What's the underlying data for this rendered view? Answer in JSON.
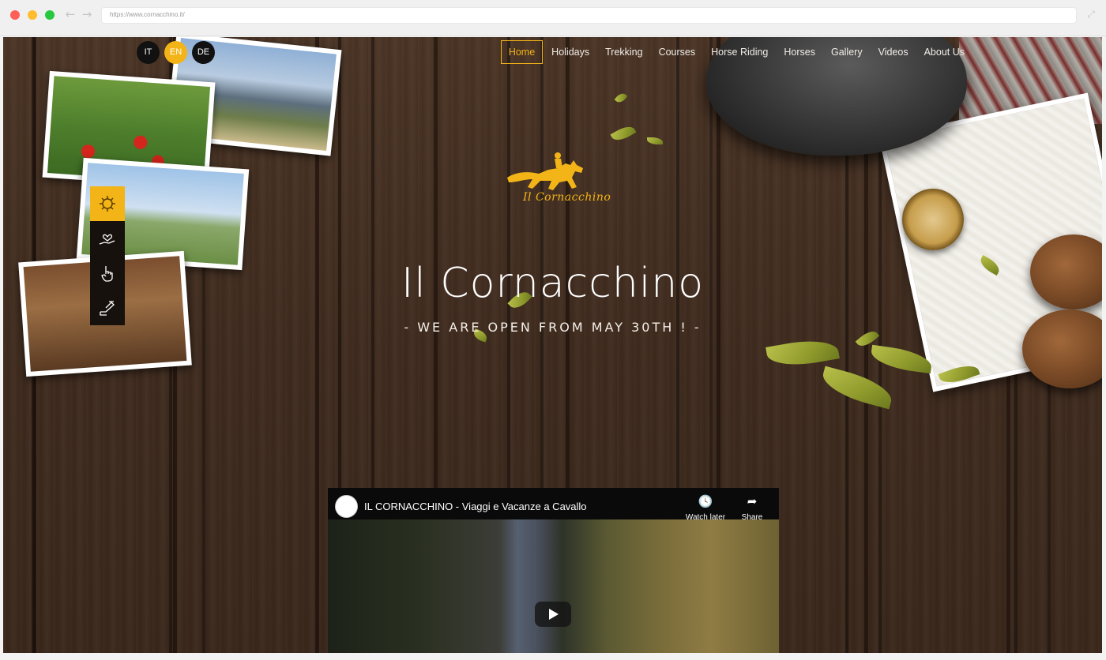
{
  "browser": {
    "url": "https://www.cornacchino.it/"
  },
  "nav": {
    "items": [
      "Home",
      "Holidays",
      "Trekking",
      "Courses",
      "Horse Riding",
      "Horses",
      "Gallery",
      "Videos",
      "About Us"
    ],
    "active": "Home"
  },
  "languages": {
    "items": [
      "IT",
      "EN",
      "DE"
    ],
    "active": "EN"
  },
  "logo": {
    "text": "Il Cornacchino"
  },
  "hero": {
    "title": "Il Cornacchino",
    "subtitle": "- WE ARE OPEN FROM MAY 30TH ! -"
  },
  "video": {
    "title": "IL CORNACCHINO - Viaggi e Vacanze a Cavallo",
    "watch_later": "Watch later",
    "share": "Share"
  },
  "sidebar": {
    "icons": [
      "covid-virus-icon",
      "heart-hand-icon",
      "touch-hand-icon",
      "handshake-icon"
    ]
  },
  "colors": {
    "accent": "#f3b417",
    "wood": "#3f2b1e",
    "nav_text": "#f1ece6"
  }
}
